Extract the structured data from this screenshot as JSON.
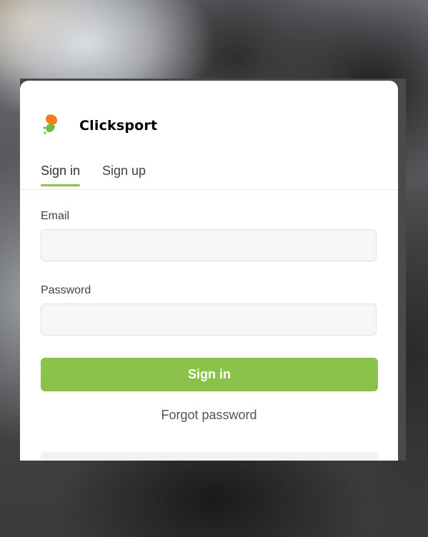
{
  "brand": {
    "name": "Clicksport",
    "logo_icon": "clicksport-logo-icon"
  },
  "tabs": [
    {
      "label": "Sign in",
      "active": true
    },
    {
      "label": "Sign up",
      "active": false
    }
  ],
  "form": {
    "email_label": "Email",
    "email_value": "",
    "password_label": "Password",
    "password_value": "",
    "submit_label": "Sign in",
    "forgot_label": "Forgot password"
  },
  "colors": {
    "accent": "#8bc34a",
    "logo_orange": "#f47c20",
    "logo_green": "#6abf3e"
  }
}
